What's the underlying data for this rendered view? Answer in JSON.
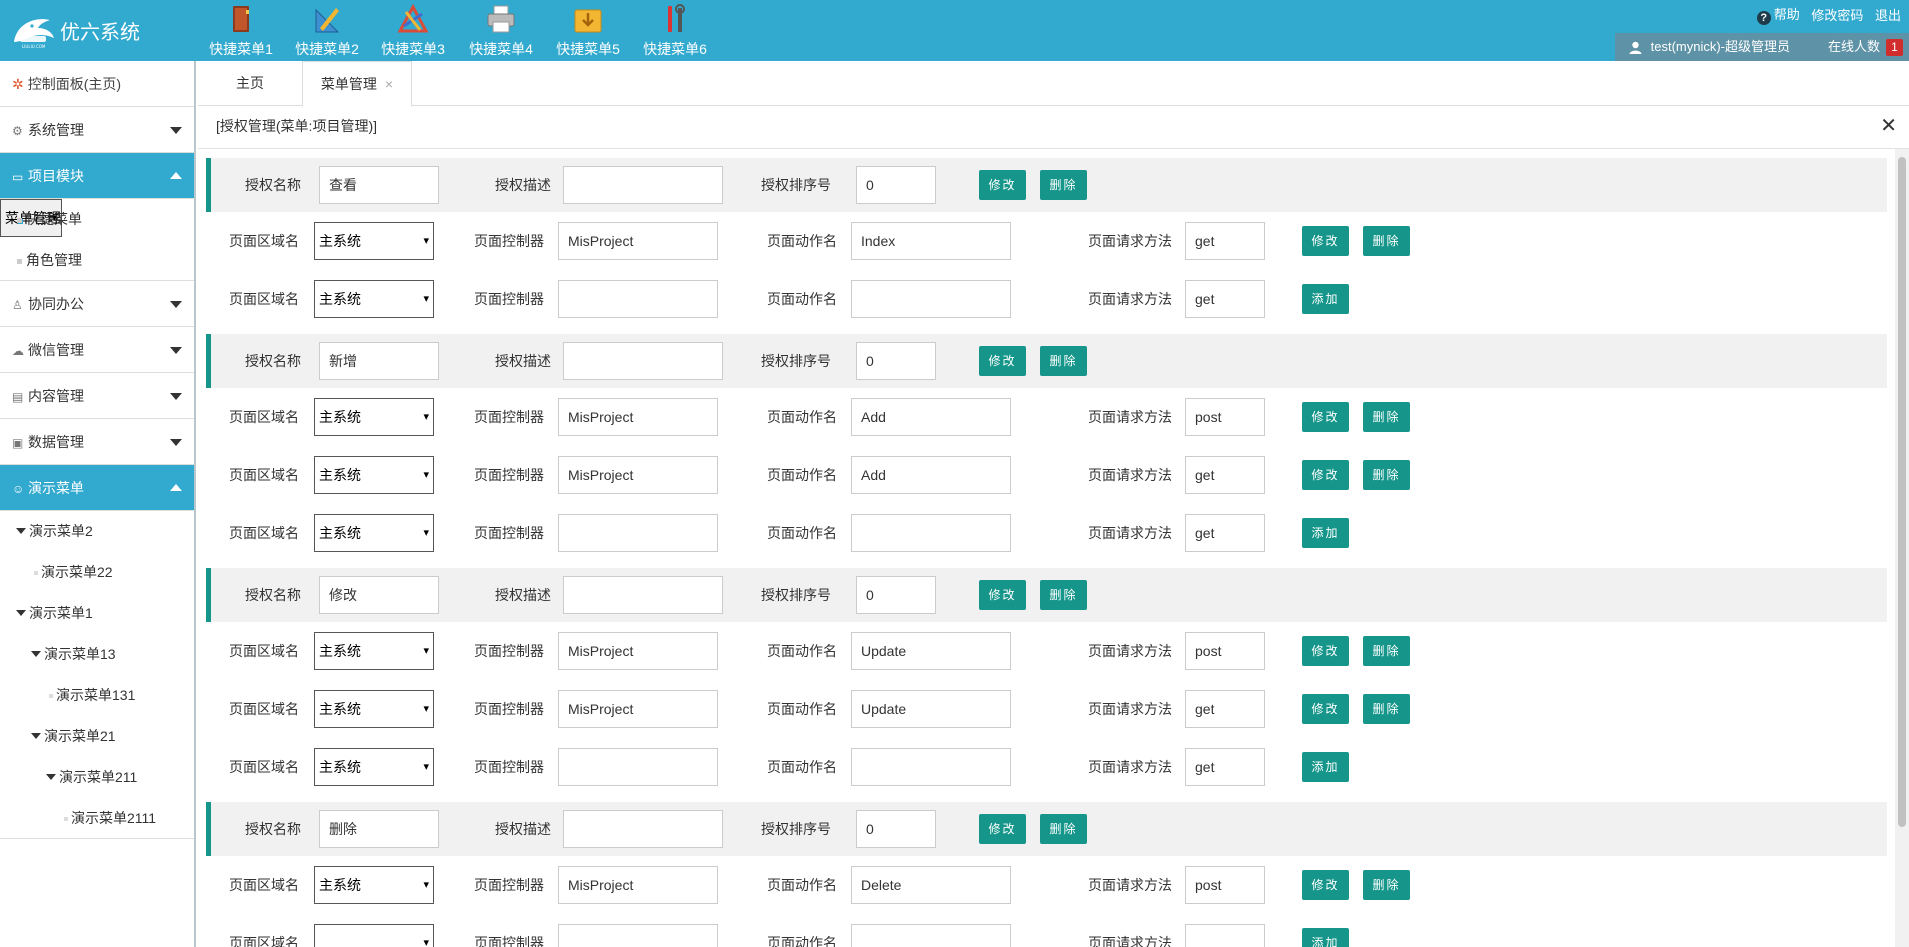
{
  "app": {
    "title": "优六系统",
    "logo_small_text": "LIULIU.COM"
  },
  "quick_menu": [
    {
      "label": "快捷菜单1",
      "icon": "book-icon"
    },
    {
      "label": "快捷菜单2",
      "icon": "ruler-pencil-icon"
    },
    {
      "label": "快捷菜单3",
      "icon": "triangle-tools-icon"
    },
    {
      "label": "快捷菜单4",
      "icon": "printer-icon"
    },
    {
      "label": "快捷菜单5",
      "icon": "download-folder-icon"
    },
    {
      "label": "快捷菜单6",
      "icon": "tools-icon"
    }
  ],
  "top_links": {
    "help": "帮助",
    "change_password": "修改密码",
    "logout": "退出"
  },
  "user": {
    "name": "test(mynick)-超级管理员",
    "online_label": "在线人数",
    "online_count": "1"
  },
  "sidebar": {
    "dashboard": "控制面板(主页)",
    "items": [
      {
        "label": "系统管理",
        "icon": "gear-icon"
      },
      {
        "label": "项目模块",
        "icon": "project-icon"
      },
      {
        "label": "协同办公",
        "icon": "users-icon"
      },
      {
        "label": "微信管理",
        "icon": "wechat-icon"
      },
      {
        "label": "内容管理",
        "icon": "content-icon"
      },
      {
        "label": "数据管理",
        "icon": "data-icon"
      },
      {
        "label": "演示菜单",
        "icon": "smile-icon"
      }
    ],
    "project_sub": [
      "菜单管理",
      "快捷菜单",
      "角色管理"
    ],
    "demo_tree": [
      "演示菜单2",
      "演示菜单22",
      "演示菜单1",
      "演示菜单13",
      "演示菜单131",
      "演示菜单21",
      "演示菜单211",
      "演示菜单2111"
    ]
  },
  "tabs": {
    "home": "主页",
    "current": "菜单管理",
    "close": "×"
  },
  "breadcrumb": "[授权管理(菜单:项目管理)]",
  "labels": {
    "auth_name": "授权名称",
    "auth_desc": "授权描述",
    "auth_order": "授权排序号",
    "area": "页面区域名",
    "controller": "页面控制器",
    "action": "页面动作名",
    "method": "页面请求方法",
    "btn_edit": "修改",
    "btn_delete": "删除",
    "btn_add": "添加"
  },
  "groups": [
    {
      "name": "查看",
      "desc": "",
      "order": "0",
      "rows": [
        {
          "area": "主系统",
          "controller": "MisProject",
          "action": "Index",
          "method": "get",
          "mode": "edit"
        },
        {
          "area": "主系统",
          "controller": "",
          "action": "",
          "method": "get",
          "mode": "add"
        }
      ]
    },
    {
      "name": "新增",
      "desc": "",
      "order": "0",
      "rows": [
        {
          "area": "主系统",
          "controller": "MisProject",
          "action": "Add",
          "method": "post",
          "mode": "edit"
        },
        {
          "area": "主系统",
          "controller": "MisProject",
          "action": "Add",
          "method": "get",
          "mode": "edit"
        },
        {
          "area": "主系统",
          "controller": "",
          "action": "",
          "method": "get",
          "mode": "add"
        }
      ]
    },
    {
      "name": "修改",
      "desc": "",
      "order": "0",
      "rows": [
        {
          "area": "主系统",
          "controller": "MisProject",
          "action": "Update",
          "method": "post",
          "mode": "edit"
        },
        {
          "area": "主系统",
          "controller": "MisProject",
          "action": "Update",
          "method": "get",
          "mode": "edit"
        },
        {
          "area": "主系统",
          "controller": "",
          "action": "",
          "method": "get",
          "mode": "add"
        }
      ]
    },
    {
      "name": "删除",
      "desc": "",
      "order": "0",
      "rows": [
        {
          "area": "主系统",
          "controller": "MisProject",
          "action": "Delete",
          "method": "post",
          "mode": "edit"
        },
        {
          "area": "",
          "controller": "",
          "action": "",
          "method": "",
          "mode": "add"
        }
      ]
    }
  ],
  "colors": {
    "header": "#32a9ce",
    "accent": "#16968a",
    "userbar": "#5e92a6"
  }
}
